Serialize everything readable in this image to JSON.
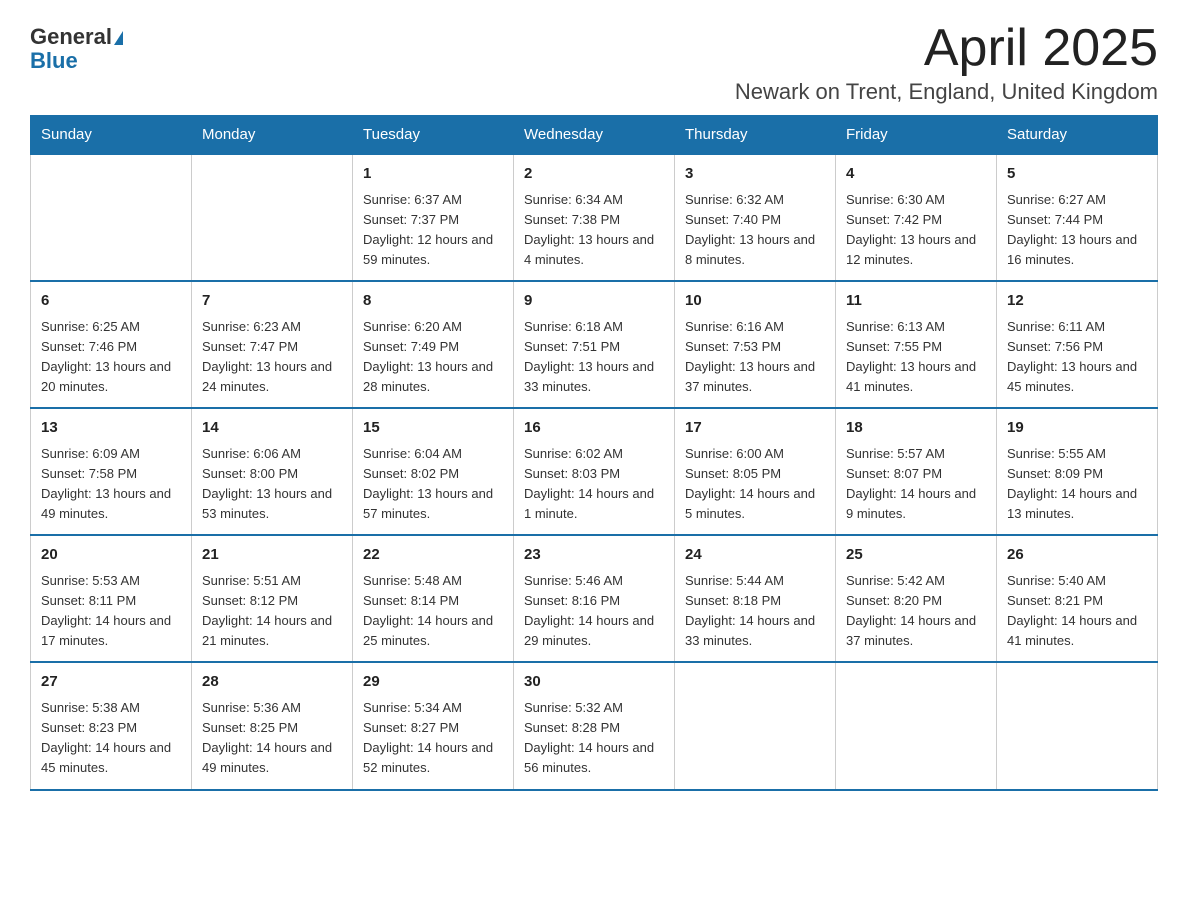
{
  "header": {
    "logo_general": "General",
    "logo_blue": "Blue",
    "month_title": "April 2025",
    "location": "Newark on Trent, England, United Kingdom"
  },
  "weekdays": [
    "Sunday",
    "Monday",
    "Tuesday",
    "Wednesday",
    "Thursday",
    "Friday",
    "Saturday"
  ],
  "weeks": [
    [
      {
        "day": "",
        "info": ""
      },
      {
        "day": "",
        "info": ""
      },
      {
        "day": "1",
        "info": "Sunrise: 6:37 AM\nSunset: 7:37 PM\nDaylight: 12 hours\nand 59 minutes."
      },
      {
        "day": "2",
        "info": "Sunrise: 6:34 AM\nSunset: 7:38 PM\nDaylight: 13 hours\nand 4 minutes."
      },
      {
        "day": "3",
        "info": "Sunrise: 6:32 AM\nSunset: 7:40 PM\nDaylight: 13 hours\nand 8 minutes."
      },
      {
        "day": "4",
        "info": "Sunrise: 6:30 AM\nSunset: 7:42 PM\nDaylight: 13 hours\nand 12 minutes."
      },
      {
        "day": "5",
        "info": "Sunrise: 6:27 AM\nSunset: 7:44 PM\nDaylight: 13 hours\nand 16 minutes."
      }
    ],
    [
      {
        "day": "6",
        "info": "Sunrise: 6:25 AM\nSunset: 7:46 PM\nDaylight: 13 hours\nand 20 minutes."
      },
      {
        "day": "7",
        "info": "Sunrise: 6:23 AM\nSunset: 7:47 PM\nDaylight: 13 hours\nand 24 minutes."
      },
      {
        "day": "8",
        "info": "Sunrise: 6:20 AM\nSunset: 7:49 PM\nDaylight: 13 hours\nand 28 minutes."
      },
      {
        "day": "9",
        "info": "Sunrise: 6:18 AM\nSunset: 7:51 PM\nDaylight: 13 hours\nand 33 minutes."
      },
      {
        "day": "10",
        "info": "Sunrise: 6:16 AM\nSunset: 7:53 PM\nDaylight: 13 hours\nand 37 minutes."
      },
      {
        "day": "11",
        "info": "Sunrise: 6:13 AM\nSunset: 7:55 PM\nDaylight: 13 hours\nand 41 minutes."
      },
      {
        "day": "12",
        "info": "Sunrise: 6:11 AM\nSunset: 7:56 PM\nDaylight: 13 hours\nand 45 minutes."
      }
    ],
    [
      {
        "day": "13",
        "info": "Sunrise: 6:09 AM\nSunset: 7:58 PM\nDaylight: 13 hours\nand 49 minutes."
      },
      {
        "day": "14",
        "info": "Sunrise: 6:06 AM\nSunset: 8:00 PM\nDaylight: 13 hours\nand 53 minutes."
      },
      {
        "day": "15",
        "info": "Sunrise: 6:04 AM\nSunset: 8:02 PM\nDaylight: 13 hours\nand 57 minutes."
      },
      {
        "day": "16",
        "info": "Sunrise: 6:02 AM\nSunset: 8:03 PM\nDaylight: 14 hours\nand 1 minute."
      },
      {
        "day": "17",
        "info": "Sunrise: 6:00 AM\nSunset: 8:05 PM\nDaylight: 14 hours\nand 5 minutes."
      },
      {
        "day": "18",
        "info": "Sunrise: 5:57 AM\nSunset: 8:07 PM\nDaylight: 14 hours\nand 9 minutes."
      },
      {
        "day": "19",
        "info": "Sunrise: 5:55 AM\nSunset: 8:09 PM\nDaylight: 14 hours\nand 13 minutes."
      }
    ],
    [
      {
        "day": "20",
        "info": "Sunrise: 5:53 AM\nSunset: 8:11 PM\nDaylight: 14 hours\nand 17 minutes."
      },
      {
        "day": "21",
        "info": "Sunrise: 5:51 AM\nSunset: 8:12 PM\nDaylight: 14 hours\nand 21 minutes."
      },
      {
        "day": "22",
        "info": "Sunrise: 5:48 AM\nSunset: 8:14 PM\nDaylight: 14 hours\nand 25 minutes."
      },
      {
        "day": "23",
        "info": "Sunrise: 5:46 AM\nSunset: 8:16 PM\nDaylight: 14 hours\nand 29 minutes."
      },
      {
        "day": "24",
        "info": "Sunrise: 5:44 AM\nSunset: 8:18 PM\nDaylight: 14 hours\nand 33 minutes."
      },
      {
        "day": "25",
        "info": "Sunrise: 5:42 AM\nSunset: 8:20 PM\nDaylight: 14 hours\nand 37 minutes."
      },
      {
        "day": "26",
        "info": "Sunrise: 5:40 AM\nSunset: 8:21 PM\nDaylight: 14 hours\nand 41 minutes."
      }
    ],
    [
      {
        "day": "27",
        "info": "Sunrise: 5:38 AM\nSunset: 8:23 PM\nDaylight: 14 hours\nand 45 minutes."
      },
      {
        "day": "28",
        "info": "Sunrise: 5:36 AM\nSunset: 8:25 PM\nDaylight: 14 hours\nand 49 minutes."
      },
      {
        "day": "29",
        "info": "Sunrise: 5:34 AM\nSunset: 8:27 PM\nDaylight: 14 hours\nand 52 minutes."
      },
      {
        "day": "30",
        "info": "Sunrise: 5:32 AM\nSunset: 8:28 PM\nDaylight: 14 hours\nand 56 minutes."
      },
      {
        "day": "",
        "info": ""
      },
      {
        "day": "",
        "info": ""
      },
      {
        "day": "",
        "info": ""
      }
    ]
  ]
}
